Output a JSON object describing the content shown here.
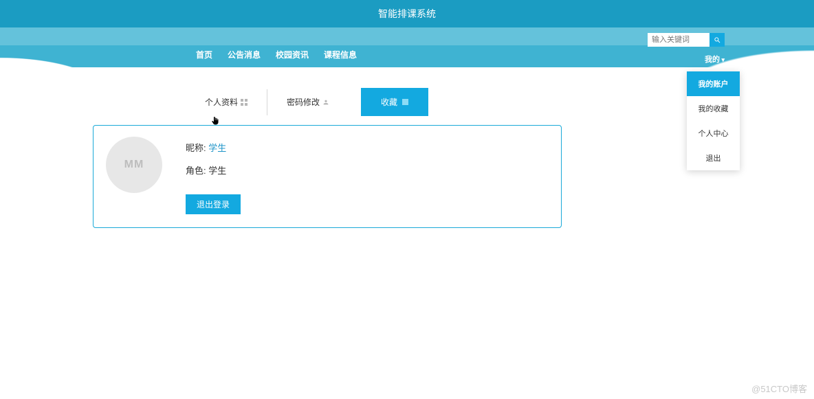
{
  "header": {
    "title": "智能排课系统"
  },
  "nav": {
    "items": [
      {
        "label": "首页"
      },
      {
        "label": "公告消息"
      },
      {
        "label": "校园资讯"
      },
      {
        "label": "课程信息"
      }
    ]
  },
  "search": {
    "placeholder": "输入关键词"
  },
  "user_menu": {
    "trigger": "我的",
    "items": [
      {
        "label": "我的账户"
      },
      {
        "label": "我的收藏"
      },
      {
        "label": "个人中心"
      },
      {
        "label": "退出"
      }
    ]
  },
  "tabs": [
    {
      "label": "个人资料"
    },
    {
      "label": "密码修改"
    },
    {
      "label": "收藏"
    }
  ],
  "profile": {
    "avatar_text": "MM",
    "nick_label": "昵称:",
    "nick_value": "学生",
    "role_label": "角色:",
    "role_value": "学生",
    "logout": "退出登录"
  },
  "watermark": "@51CTO博客",
  "colors": {
    "primary": "#13a9e0",
    "navTop": "#1b9cc2",
    "navBand": "#3fb3d2",
    "navLight": "#64c2db"
  }
}
